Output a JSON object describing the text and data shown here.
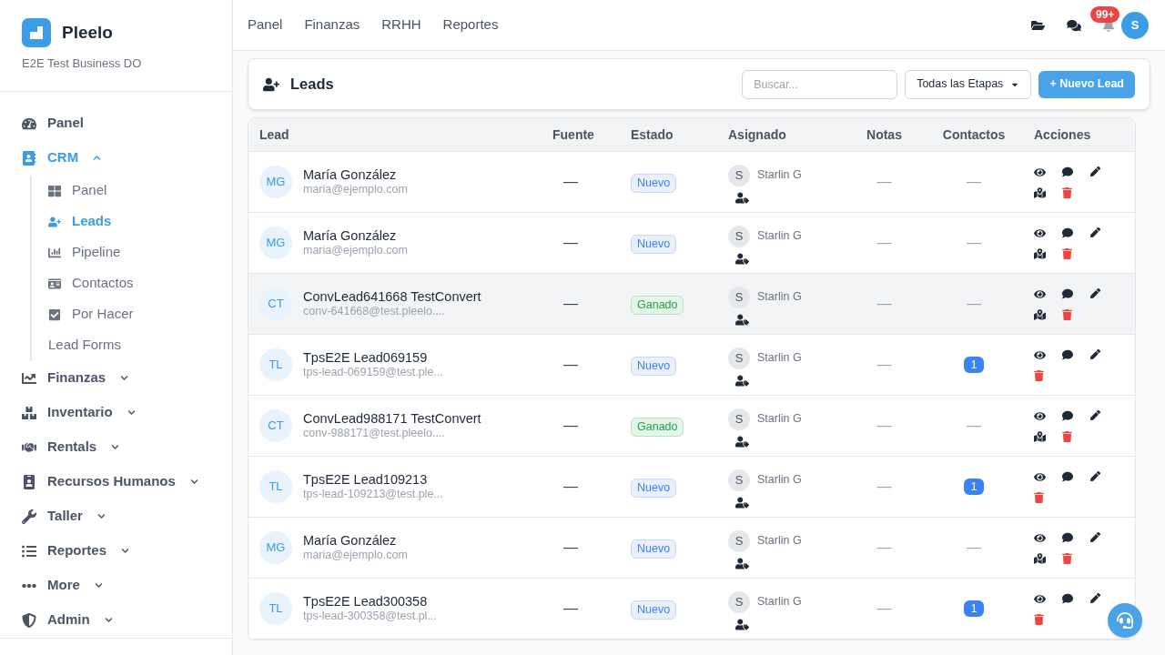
{
  "brand": {
    "name": "Pleelo",
    "business": "E2E Test Business DO"
  },
  "sidebar": {
    "items": [
      {
        "label": "Panel",
        "selected": false
      },
      {
        "label": "CRM",
        "selected": true,
        "expanded": true,
        "children": [
          {
            "label": "Panel",
            "selected": false
          },
          {
            "label": "Leads",
            "selected": true
          },
          {
            "label": "Pipeline",
            "selected": false
          },
          {
            "label": "Contactos",
            "selected": false
          },
          {
            "label": "Por Hacer",
            "selected": false
          },
          {
            "label": "Lead Forms",
            "selected": false
          }
        ]
      },
      {
        "label": "Finanzas",
        "selected": false,
        "expanded": false
      },
      {
        "label": "Inventario",
        "selected": false,
        "expanded": false
      },
      {
        "label": "Rentals",
        "selected": false,
        "expanded": false
      },
      {
        "label": "Recursos Humanos",
        "selected": false,
        "expanded": false
      },
      {
        "label": "Taller",
        "selected": false,
        "expanded": false
      },
      {
        "label": "Reportes",
        "selected": false,
        "expanded": false
      },
      {
        "label": "More",
        "selected": false,
        "expanded": false
      },
      {
        "label": "Admin",
        "selected": false,
        "expanded": false
      }
    ]
  },
  "topnav": [
    "Panel",
    "Finanzas",
    "RRHH",
    "Reportes"
  ],
  "header": {
    "notifications": "99+",
    "avatar": "S"
  },
  "page": {
    "title": "Leads",
    "search": {
      "placeholder": "Buscar..."
    },
    "stage_filter": "Todas las Etapas",
    "new_button": "+ Nuevo Lead"
  },
  "table": {
    "columns": [
      "Lead",
      "Fuente",
      "Estado",
      "Asignado",
      "Notas",
      "Contactos",
      "Acciones"
    ],
    "rows": [
      {
        "initials": "MG",
        "name": "María González",
        "email": "maria@ejemplo.com",
        "source": "—",
        "status": {
          "label": "Nuevo",
          "kind": "new"
        },
        "assignee_initial": "S",
        "assignee": "Starlin G",
        "notes": "—",
        "contacts": {
          "value": "—",
          "kind": "none"
        },
        "convertible": true,
        "hovered": false
      },
      {
        "initials": "MG",
        "name": "María González",
        "email": "maria@ejemplo.com",
        "source": "—",
        "status": {
          "label": "Nuevo",
          "kind": "new"
        },
        "assignee_initial": "S",
        "assignee": "Starlin G",
        "notes": "—",
        "contacts": {
          "value": "—",
          "kind": "none"
        },
        "convertible": true,
        "hovered": false
      },
      {
        "initials": "CT",
        "name": "ConvLead641668 TestConvert",
        "email": "conv-641668@test.pleelo....",
        "source": "—",
        "status": {
          "label": "Ganado",
          "kind": "won"
        },
        "assignee_initial": "S",
        "assignee": "Starlin G",
        "notes": "—",
        "contacts": {
          "value": "—",
          "kind": "none"
        },
        "convertible": true,
        "hovered": true
      },
      {
        "initials": "TL",
        "name": "TpsE2E Lead069159",
        "email": "tps-lead-069159@test.ple...",
        "source": "—",
        "status": {
          "label": "Nuevo",
          "kind": "new"
        },
        "assignee_initial": "S",
        "assignee": "Starlin G",
        "notes": "—",
        "contacts": {
          "value": "1",
          "kind": "count"
        },
        "convertible": false,
        "hovered": false
      },
      {
        "initials": "CT",
        "name": "ConvLead988171 TestConvert",
        "email": "conv-988171@test.pleelo....",
        "source": "—",
        "status": {
          "label": "Ganado",
          "kind": "won"
        },
        "assignee_initial": "S",
        "assignee": "Starlin G",
        "notes": "—",
        "contacts": {
          "value": "—",
          "kind": "none"
        },
        "convertible": true,
        "hovered": false
      },
      {
        "initials": "TL",
        "name": "TpsE2E Lead109213",
        "email": "tps-lead-109213@test.ple...",
        "source": "—",
        "status": {
          "label": "Nuevo",
          "kind": "new"
        },
        "assignee_initial": "S",
        "assignee": "Starlin G",
        "notes": "—",
        "contacts": {
          "value": "1",
          "kind": "count"
        },
        "convertible": false,
        "hovered": false
      },
      {
        "initials": "MG",
        "name": "María González",
        "email": "maria@ejemplo.com",
        "source": "—",
        "status": {
          "label": "Nuevo",
          "kind": "new"
        },
        "assignee_initial": "S",
        "assignee": "Starlin G",
        "notes": "—",
        "contacts": {
          "value": "—",
          "kind": "none"
        },
        "convertible": true,
        "hovered": false
      },
      {
        "initials": "TL",
        "name": "TpsE2E Lead300358",
        "email": "tps-lead-300358@test.pl...",
        "source": "—",
        "status": {
          "label": "Nuevo",
          "kind": "new"
        },
        "assignee_initial": "S",
        "assignee": "Starlin G",
        "notes": "—",
        "contacts": {
          "value": "1",
          "kind": "count"
        },
        "convertible": false,
        "hovered": false
      }
    ]
  }
}
